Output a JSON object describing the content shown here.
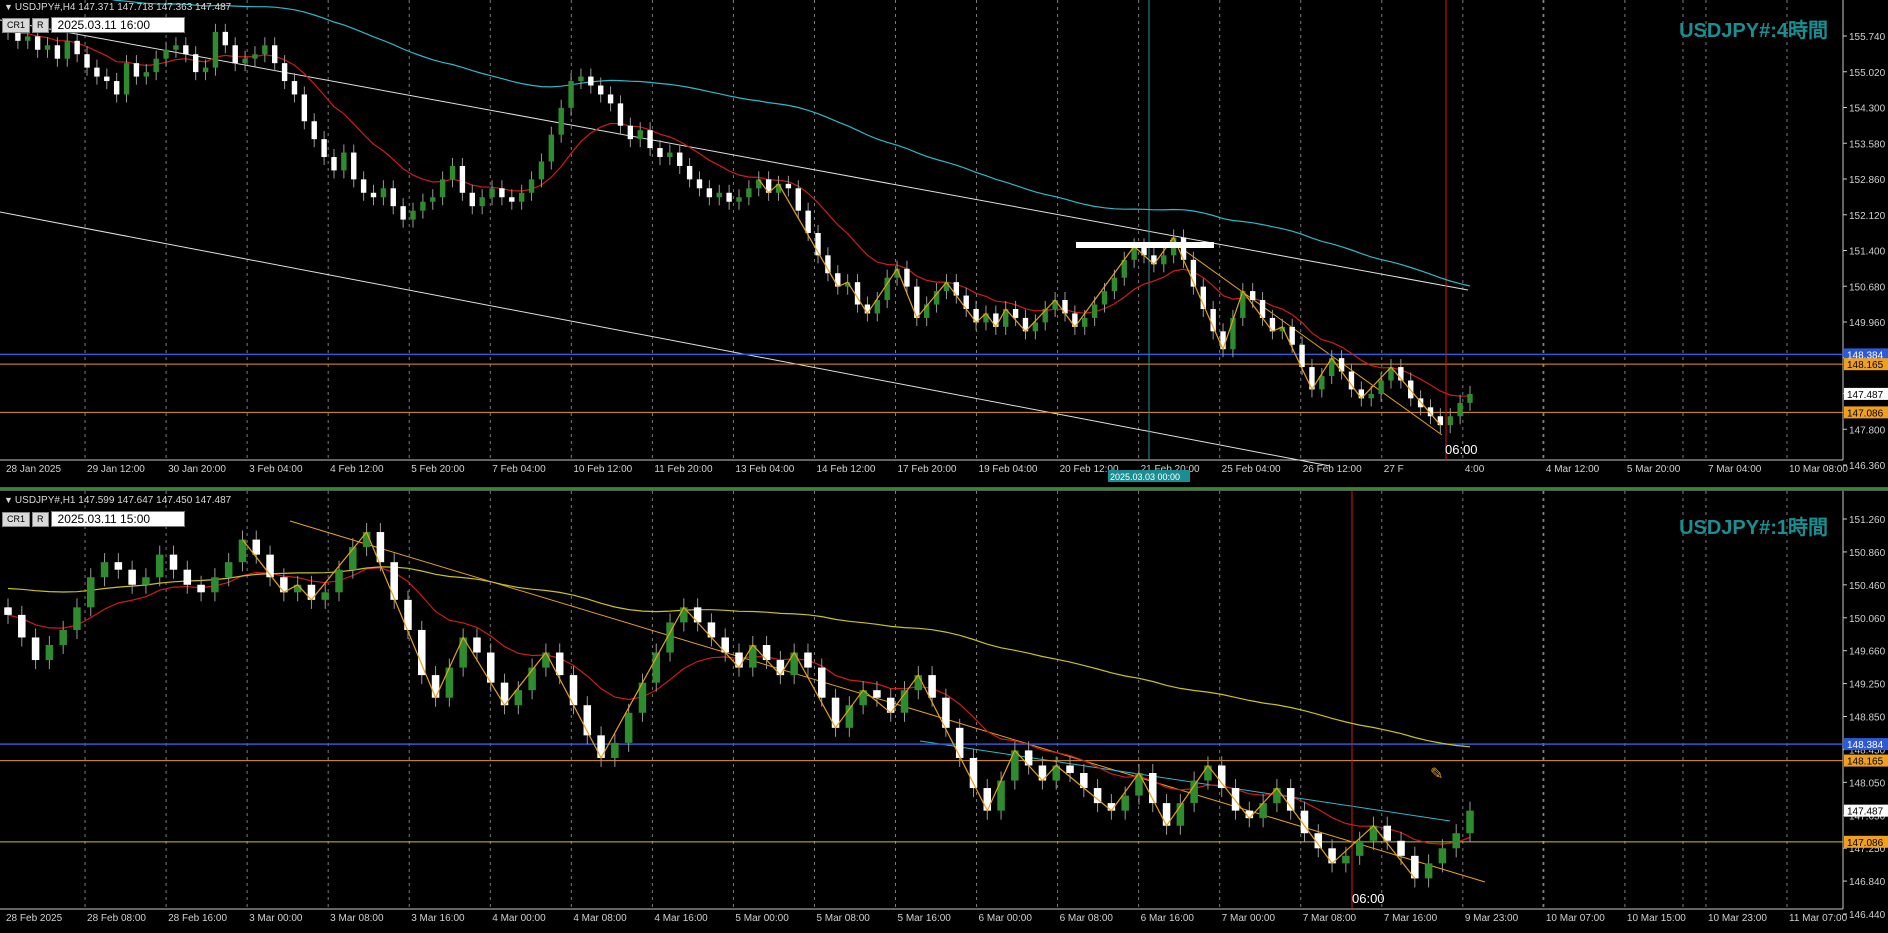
{
  "colors": {
    "background": "#000000",
    "bull_candle": "#2e8b2e",
    "bear_candle": "#ffffff",
    "wick": "#9a9a9a",
    "ma_red": "#d01b1b",
    "ma_cyan": "#2fb8c8",
    "ma_yellow": "#c9c21a",
    "zigzag": "#e5a21a",
    "trend_white": "#e0e0e0",
    "trend_orange": "#e5a21a",
    "level_blue": "#2d5ad6",
    "level_orange": "#e59a1a",
    "level_yellow": "#cfc315",
    "vline_red": "#d51a1a",
    "vline_cyan": "#2b8fa0",
    "grid": "#b0b0b0",
    "title": "#1a8f93",
    "label_orange_bg": "#f0a020",
    "label_white_bg": "#ffffff"
  },
  "pane1": {
    "header": "USDJPY#,H4  147.371 147.718 147.363 147.487",
    "btn_cr": "CR1",
    "btn_r": "R",
    "time_value": "2025.03.11 16:00",
    "title": "USDJPY#:4時間",
    "time_marker": "06:00",
    "crosshair_time": "2025.03.03 00:00",
    "price_labels": {
      "blue": "148.384",
      "orange": "148.165",
      "current": "147.487",
      "yellow": "147.086"
    },
    "levels": {
      "blue": 148.384,
      "orange": 148.165,
      "yellow": 147.086
    },
    "x_labels": [
      "28 Jan 2025",
      "29 Jan 12:00",
      "30 Jan 20:00",
      "3 Feb 04:00",
      "4 Feb 12:00",
      "5 Feb 20:00",
      "7 Feb 04:00",
      "10 Feb 12:00",
      "11 Feb 20:00",
      "13 Feb 04:00",
      "14 Feb 12:00",
      "17 Feb 20:00",
      "19 Feb 04:00",
      "20 Feb 12:00",
      "21 Feb 20:00",
      "25 Feb 04:00",
      "26 Feb 12:00",
      "27 F",
      "4:00",
      "4 Mar 12:00",
      "5 Mar 20:00",
      "7 Mar 04:00",
      "10 Mar 08:00"
    ],
    "y_labels": [
      "155.740",
      "155.020",
      "154.300",
      "153.580",
      "152.860",
      "152.120",
      "151.400",
      "150.680",
      "149.960",
      "149.240",
      "148.520",
      "147.800",
      "146.360"
    ],
    "chart_data": {
      "type": "candlestick",
      "timeframe": "H4",
      "symbol": "USDJPY#",
      "close": [
        155.6,
        155.4,
        155.5,
        155.2,
        155.3,
        155.0,
        155.4,
        155.1,
        154.8,
        154.6,
        154.5,
        154.2,
        154.9,
        154.6,
        154.7,
        155.0,
        155.2,
        155.3,
        155.1,
        154.7,
        154.8,
        155.6,
        155.3,
        154.9,
        155.0,
        155.1,
        155.3,
        154.9,
        154.5,
        154.2,
        153.6,
        153.2,
        152.8,
        152.5,
        152.9,
        152.3,
        152.0,
        151.9,
        152.1,
        151.7,
        151.4,
        151.6,
        151.8,
        151.9,
        152.3,
        152.6,
        152.0,
        151.7,
        151.9,
        152.1,
        151.9,
        151.8,
        152.0,
        152.3,
        152.7,
        153.3,
        153.9,
        154.5,
        154.6,
        154.4,
        154.2,
        154.0,
        153.5,
        153.2,
        153.4,
        153.0,
        152.8,
        152.9,
        152.6,
        152.3,
        152.1,
        151.9,
        152.0,
        151.8,
        151.9,
        152.1,
        152.3,
        152.0,
        152.2,
        152.1,
        151.6,
        151.1,
        150.6,
        150.2,
        149.9,
        150.0,
        149.5,
        149.3,
        149.6,
        150.1,
        150.3,
        149.9,
        149.2,
        149.5,
        149.8,
        150.0,
        149.7,
        149.4,
        149.1,
        149.3,
        149.0,
        149.4,
        149.2,
        148.9,
        149.1,
        149.4,
        149.6,
        149.3,
        149.0,
        149.2,
        149.5,
        149.8,
        150.1,
        150.5,
        150.8,
        150.6,
        150.4,
        150.6,
        151.0,
        150.5,
        149.9,
        149.4,
        148.9,
        148.5,
        149.2,
        149.8,
        149.6,
        149.2,
        148.9,
        149.0,
        148.6,
        148.1,
        147.6,
        147.9,
        148.3,
        148.0,
        147.6,
        147.4,
        147.5,
        147.8,
        148.1,
        147.8,
        147.4,
        147.2,
        147.0,
        146.8,
        147.0,
        147.3,
        147.5
      ],
      "ylim": [
        146.2,
        156.0
      ]
    }
  },
  "pane2": {
    "header": "USDJPY#,H1  147.599 147.647 147.450 147.487",
    "btn_cr": "CR1",
    "btn_r": "R",
    "time_value": "2025.03.11 15:00",
    "title": "USDJPY#:1時間",
    "time_marker": "06:00",
    "price_labels": {
      "blue": "148.384",
      "orange": "148.165",
      "current": "147.487",
      "yellow": "147.086"
    },
    "levels": {
      "blue": 148.384,
      "orange": 148.165,
      "yellow": 147.086
    },
    "x_labels": [
      "28 Feb 2025",
      "28 Feb 08:00",
      "28 Feb 16:00",
      "3 Mar 00:00",
      "3 Mar 08:00",
      "3 Mar 16:00",
      "4 Mar 00:00",
      "4 Mar 08:00",
      "4 Mar 16:00",
      "5 Mar 00:00",
      "5 Mar 08:00",
      "5 Mar 16:00",
      "6 Mar 00:00",
      "6 Mar 08:00",
      "6 Mar 16:00",
      "7 Mar 00:00",
      "7 Mar 08:00",
      "7 Mar 16:00",
      "9 Mar 23:00",
      "10 Mar 07:00",
      "10 Mar 15:00",
      "10 Mar 23:00",
      "11 Mar 07:00"
    ],
    "y_labels": [
      "151.260",
      "150.860",
      "150.460",
      "150.060",
      "149.660",
      "149.250",
      "148.850",
      "148.450",
      "148.050",
      "147.650",
      "147.250",
      "146.840",
      "146.440"
    ],
    "chart_data": {
      "type": "candlestick",
      "timeframe": "H1",
      "symbol": "USDJPY#",
      "close": [
        150.1,
        149.8,
        149.5,
        149.7,
        149.9,
        150.2,
        150.6,
        150.8,
        150.7,
        150.5,
        150.6,
        150.9,
        150.7,
        150.5,
        150.4,
        150.6,
        150.8,
        151.1,
        150.9,
        150.6,
        150.4,
        150.5,
        150.3,
        150.4,
        150.7,
        151.0,
        151.2,
        150.8,
        150.3,
        149.9,
        149.3,
        149.0,
        149.4,
        149.8,
        149.6,
        149.2,
        148.9,
        149.1,
        149.4,
        149.6,
        149.3,
        148.9,
        148.5,
        148.2,
        148.4,
        148.8,
        149.2,
        149.6,
        150.0,
        150.2,
        150.0,
        149.8,
        149.6,
        149.4,
        149.7,
        149.5,
        149.3,
        149.6,
        149.4,
        149.0,
        148.6,
        148.9,
        149.1,
        149.0,
        148.8,
        149.1,
        149.3,
        149.0,
        148.6,
        148.2,
        147.8,
        147.5,
        147.9,
        148.3,
        148.1,
        147.9,
        148.1,
        148.0,
        147.8,
        147.6,
        147.5,
        147.7,
        148.0,
        147.6,
        147.3,
        147.6,
        147.9,
        148.1,
        147.8,
        147.5,
        147.4,
        147.6,
        147.8,
        147.5,
        147.2,
        147.0,
        146.8,
        146.9,
        147.1,
        147.3,
        147.1,
        146.9,
        146.6,
        146.8,
        147.0,
        147.2,
        147.5
      ],
      "ylim": [
        146.3,
        151.4
      ]
    }
  }
}
